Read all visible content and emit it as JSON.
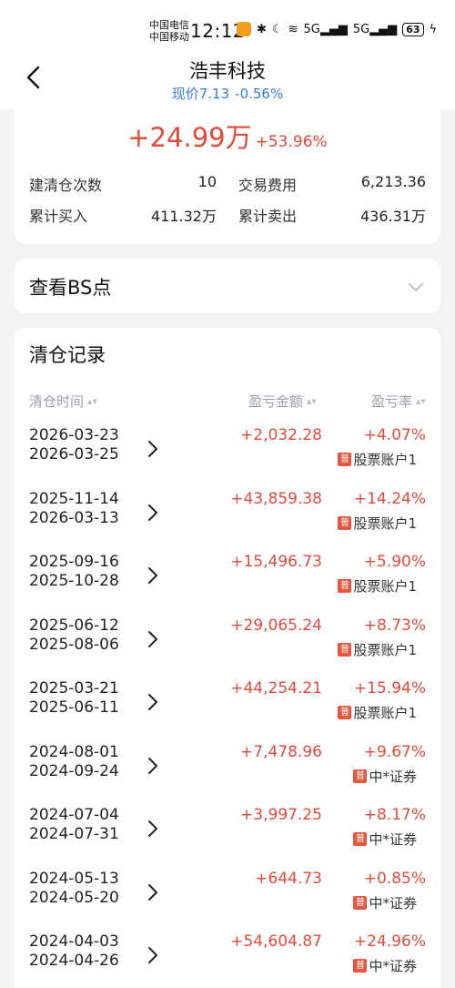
{
  "status_bar": {
    "carrier1": "中国电信",
    "carrier2": "中国移动",
    "time": "12:12",
    "network1": "5G",
    "network2": "5G",
    "battery": "63"
  },
  "header": {
    "title": "浩丰科技",
    "price_label": "现价7.13",
    "price_change": "-0.56%"
  },
  "summary": {
    "profit": "+24.99万",
    "profit_rate": "+53.96%",
    "stats": [
      {
        "label": "建清仓次数",
        "value": "10"
      },
      {
        "label": "交易费用",
        "value": "6,213.36"
      },
      {
        "label": "累计买入",
        "value": "411.32万"
      },
      {
        "label": "累计卖出",
        "value": "436.31万"
      }
    ]
  },
  "bs_section": {
    "label": "查看BS点"
  },
  "records": {
    "title": "清仓记录",
    "columns": {
      "time": "清仓时间",
      "amount": "盈亏金额",
      "rate": "盈亏率"
    },
    "badge": "普",
    "rows": [
      {
        "start": "2026-03-23",
        "end": "2026-03-25",
        "amount": "+2,032.28",
        "rate": "+4.07%",
        "account": "股票账户1"
      },
      {
        "start": "2025-11-14",
        "end": "2026-03-13",
        "amount": "+43,859.38",
        "rate": "+14.24%",
        "account": "股票账户1"
      },
      {
        "start": "2025-09-16",
        "end": "2025-10-28",
        "amount": "+15,496.73",
        "rate": "+5.90%",
        "account": "股票账户1"
      },
      {
        "start": "2025-06-12",
        "end": "2025-08-06",
        "amount": "+29,065.24",
        "rate": "+8.73%",
        "account": "股票账户1"
      },
      {
        "start": "2025-03-21",
        "end": "2025-06-11",
        "amount": "+44,254.21",
        "rate": "+15.94%",
        "account": "股票账户1"
      },
      {
        "start": "2024-08-01",
        "end": "2024-09-24",
        "amount": "+7,478.96",
        "rate": "+9.67%",
        "account": "中*证券"
      },
      {
        "start": "2024-07-04",
        "end": "2024-07-31",
        "amount": "+3,997.25",
        "rate": "+8.17%",
        "account": "中*证券"
      },
      {
        "start": "2024-05-13",
        "end": "2024-05-20",
        "amount": "+644.73",
        "rate": "+0.85%",
        "account": "中*证券"
      },
      {
        "start": "2024-04-03",
        "end": "2024-04-26",
        "amount": "+54,604.87",
        "rate": "+24.96%",
        "account": "中*证券"
      }
    ]
  },
  "colors": {
    "profit": "#e34a3b",
    "link_blue": "#3a7be0",
    "badge": "#e5573f"
  }
}
